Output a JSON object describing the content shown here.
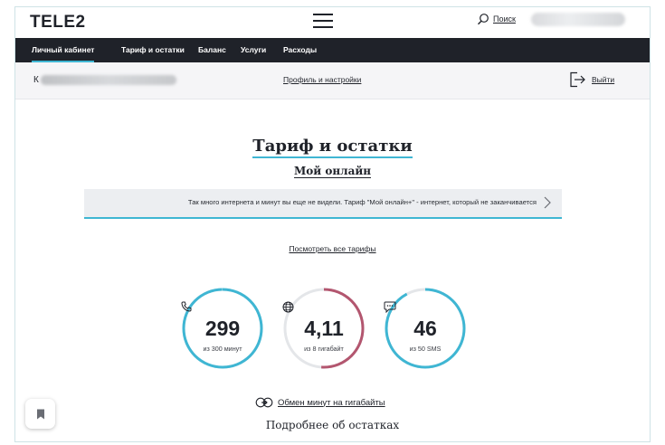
{
  "header": {
    "logo": "TELE2",
    "search_label": "Поиск"
  },
  "nav": {
    "items": [
      {
        "label": "Личный кабинет",
        "active": true
      },
      {
        "label": "Тариф и остатки",
        "active": false
      },
      {
        "label": "Баланс",
        "active": false
      },
      {
        "label": "Услуги",
        "active": false
      },
      {
        "label": "Расходы",
        "active": false
      }
    ]
  },
  "subbar": {
    "user_initial": "К",
    "profile_link": "Профиль и настройки",
    "logout_label": "Выйти"
  },
  "main": {
    "title": "Тариф и остатки",
    "plan_name": "Мой онлайн",
    "promo_text": "Так много интернета и минут вы еще не видели. Тариф \"Мой онлайн+\" - интернет, который не заканчивается",
    "all_tariffs_link": "Посмотреть все тарифы",
    "exchange_link": "Обмен минут на гигабайты",
    "more_remains": "Подробнее об остатках"
  },
  "remains": [
    {
      "icon": "phone-icon",
      "value": "299",
      "caption": "из 300 минут",
      "fraction": 0.997,
      "color": "#3fb6d3"
    },
    {
      "icon": "globe-icon",
      "value": "4,11",
      "caption": "из 8 гигабайт",
      "fraction": 0.51,
      "color": "#b3566f"
    },
    {
      "icon": "chat-icon",
      "value": "46",
      "caption": "из 50 SMS",
      "fraction": 0.92,
      "color": "#3fb6d3"
    }
  ],
  "colors": {
    "accent": "#3fb6d3",
    "nav_background": "#1f2229",
    "internet_ring": "#b3566f",
    "track": "#e4e6e9"
  }
}
